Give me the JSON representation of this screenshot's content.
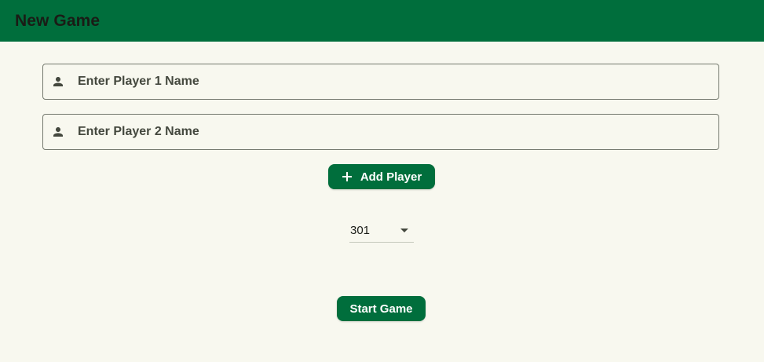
{
  "appbar": {
    "title": "New Game"
  },
  "players": {
    "player1": {
      "value": "",
      "placeholder": "Enter Player 1 Name",
      "icon": "person-icon"
    },
    "player2": {
      "value": "",
      "placeholder": "Enter Player 2 Name",
      "icon": "person-icon"
    }
  },
  "actions": {
    "add_player_label": "Add Player",
    "add_player_icon": "plus-icon",
    "start_game_label": "Start Game"
  },
  "game_mode": {
    "selected": "301",
    "icon": "dropdown-arrow-icon"
  },
  "colors": {
    "primary": "#006e3c",
    "background": "#f8f8ef",
    "on_surface_variant": "#44483e",
    "outline": "#74796e"
  }
}
